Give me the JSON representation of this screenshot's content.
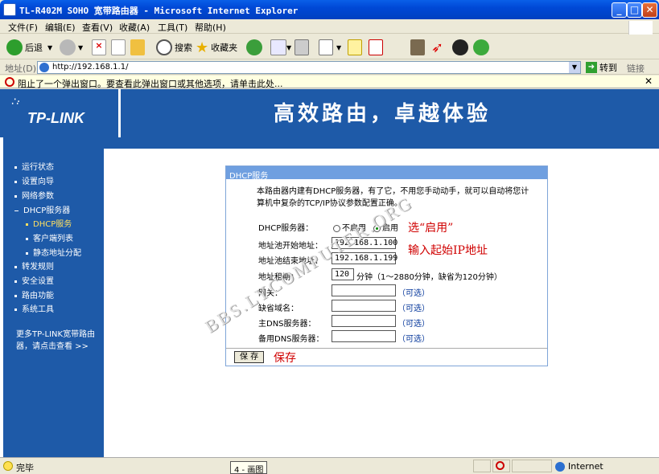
{
  "window": {
    "title": "TL-R402M SOHO 宽带路由器 - Microsoft Internet Explorer"
  },
  "menu": [
    "文件(F)",
    "编辑(E)",
    "查看(V)",
    "收藏(A)",
    "工具(T)",
    "帮助(H)"
  ],
  "toolbar": {
    "back": "后退",
    "search": "搜索",
    "favorites": "收藏夹"
  },
  "address": {
    "label": "地址(D)",
    "url": "http://192.168.1.1/",
    "go": "转到",
    "links": "链接"
  },
  "popup": {
    "text": "阻止了一个弹出窗口。要查看此弹出窗口或其他选项，请单击此处..."
  },
  "banner": {
    "logo": "TP-LINK",
    "slogan": "高效路由，卓越体验"
  },
  "nav": [
    {
      "label": "运行状态"
    },
    {
      "label": "设置向导"
    },
    {
      "label": "网络参数"
    },
    {
      "label": "DHCP服务器"
    },
    {
      "label": "DHCP服务"
    },
    {
      "label": "客户端列表"
    },
    {
      "label": "静态地址分配"
    },
    {
      "label": "转发规则"
    },
    {
      "label": "安全设置"
    },
    {
      "label": "路由功能"
    },
    {
      "label": "系统工具"
    }
  ],
  "more": "更多TP-LINK宽带路由器，请点击查看 >>",
  "panel": {
    "header": "DHCP服务",
    "desc": "本路由器内建有DHCP服务器，有了它，不用您手动动手，就可以自动将您计算机中复杂的TCP/IP协议参数配置正确。",
    "dhcp_label": "DHCP服务器：",
    "disable": "不启用",
    "enable": "启用",
    "start_label": "地址池开始地址：",
    "start_value": "192.168.1.100",
    "end_label": "地址池结束地址：",
    "end_value": "192.168.1.199",
    "lease_label": "地址租期：",
    "lease_value": "120",
    "lease_hint": "分钟（1～2880分钟，缺省为120分钟）",
    "gateway_label": "网关：",
    "domain_label": "缺省域名：",
    "dns1_label": "主DNS服务器：",
    "dns2_label": "备用DNS服务器：",
    "optional": "（可选）",
    "save": "保 存"
  },
  "annotations": {
    "enable_note": "选“启用”",
    "ip_note": "输入起始IP地址",
    "save_note": "保存"
  },
  "watermark": "BBS.LYCOMPUTER.ORG",
  "status": {
    "text": "完毕",
    "zone": "Internet",
    "task": "4 - 画图"
  }
}
